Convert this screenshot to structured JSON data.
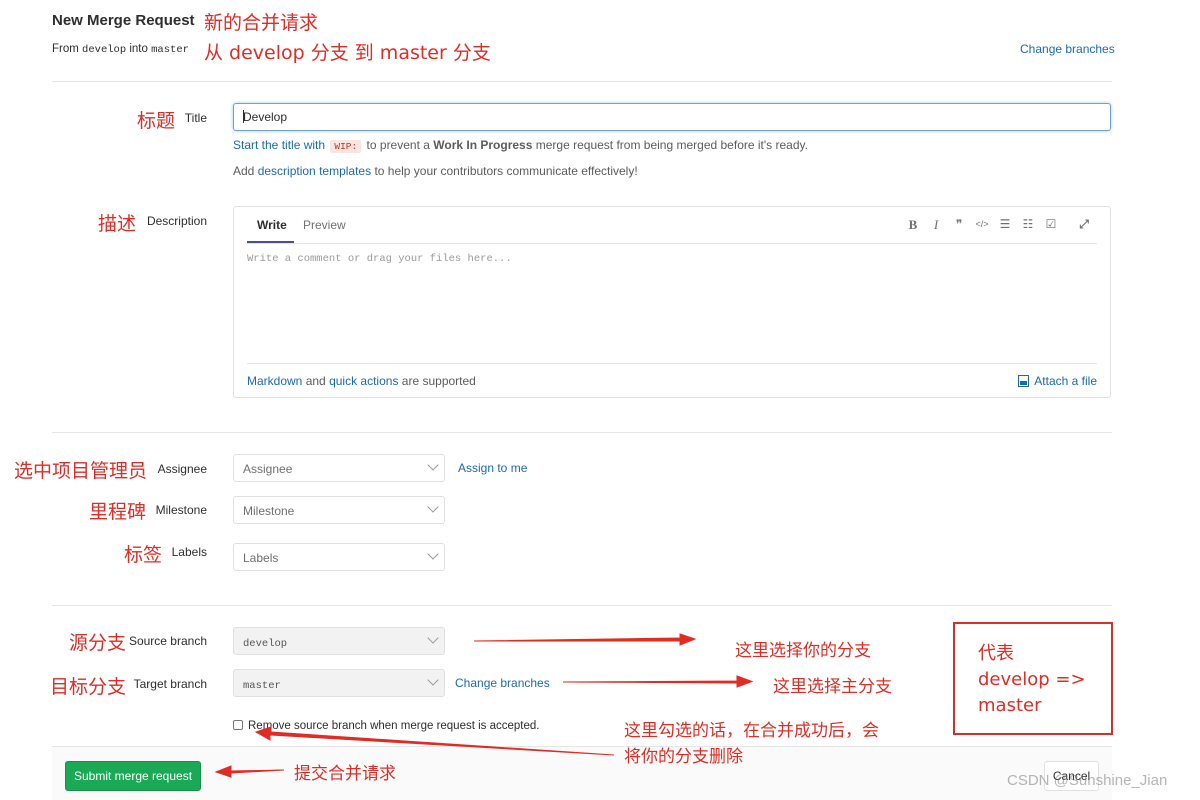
{
  "header": {
    "title": "New Merge Request",
    "from_prefix": "From",
    "source": "develop",
    "into": "into",
    "target": "master",
    "change_branches": "Change branches"
  },
  "labels": {
    "title": "Title",
    "description": "Description",
    "assignee": "Assignee",
    "milestone": "Milestone",
    "labels": "Labels",
    "source_branch": "Source branch",
    "target_branch": "Target branch"
  },
  "title_field": {
    "value": "Develop"
  },
  "help": {
    "start_link": "Start the title with",
    "wip": "WIP:",
    "to_prevent": "to prevent a",
    "wip_bold": "Work In Progress",
    "rest": "merge request from being merged before it's ready.",
    "add": "Add",
    "templates_link": "description templates",
    "templates_rest": "to help your contributors communicate effectively!"
  },
  "editor": {
    "tab_write": "Write",
    "tab_preview": "Preview",
    "toolbar": [
      {
        "icon": "bold-icon",
        "glyph": "B"
      },
      {
        "icon": "italic-icon",
        "glyph": "I"
      },
      {
        "icon": "quote-icon",
        "glyph": "❞"
      },
      {
        "icon": "code-icon",
        "glyph": "</>"
      },
      {
        "icon": "bullet-list-icon",
        "glyph": "☰"
      },
      {
        "icon": "numbered-list-icon",
        "glyph": "☷"
      },
      {
        "icon": "task-list-icon",
        "glyph": "☑"
      },
      {
        "icon": "fullscreen-icon",
        "glyph": "⤢"
      }
    ],
    "placeholder": "Write a comment or drag your files here...",
    "markdown_link": "Markdown",
    "and": "and",
    "quick_actions_link": "quick actions",
    "supported": "are supported",
    "attach_file": "Attach a file"
  },
  "selects": {
    "assignee": "Assignee",
    "assign_to_me": "Assign to me",
    "milestone": "Milestone",
    "labels": "Labels",
    "source_branch": "develop",
    "target_branch": "master",
    "change_branches": "Change branches"
  },
  "remove_source_branch": "Remove source branch when merge request is accepted.",
  "buttons": {
    "submit": "Submit merge request",
    "cancel": "Cancel"
  },
  "annotations": {
    "new_mr": "新的合并请求",
    "from_to": "从 develop 分支 到 master 分支",
    "title": "标题",
    "description": "描述",
    "assignee": "选中项目管理员",
    "milestone": "里程碑",
    "labels": "标签",
    "source": "源分支",
    "target": "目标分支",
    "choose_yours": "这里选择你的分支",
    "choose_main": "这里选择主分支",
    "remove_line1": "这里勾选的话，在合并成功后，会",
    "remove_line2": "将你的分支删除",
    "submit": "提交合并请求",
    "box_line1": "代表",
    "box_line2": "develop =>",
    "box_line3": "master"
  },
  "colors": {
    "accent_link": "#1b69b6",
    "submit_green": "#1aaa55",
    "annotation_red": "#e12b24"
  },
  "watermark": "CSDN @Sunshine_Jian"
}
